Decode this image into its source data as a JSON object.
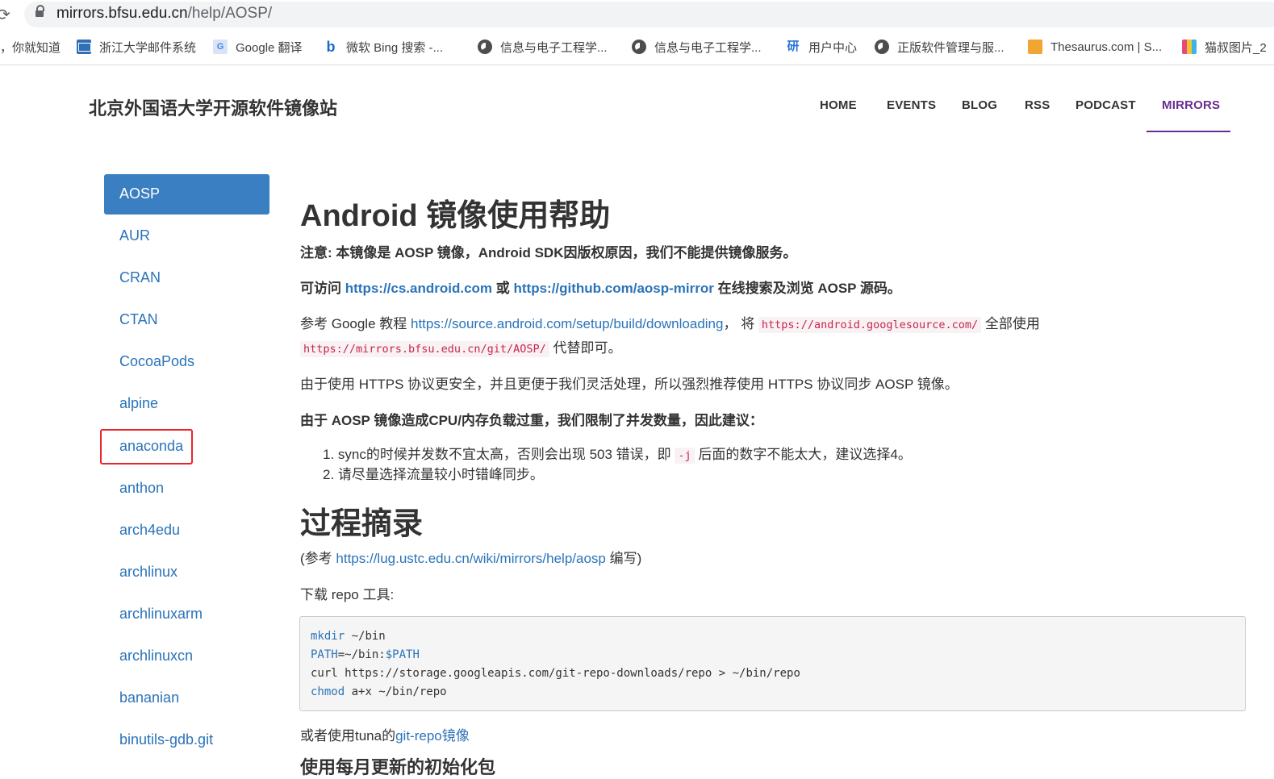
{
  "browser": {
    "url_host": "mirrors.bfsu.edu.cn",
    "url_path": "/help/AOSP/",
    "bookmarks": [
      {
        "label": "，你就知道",
        "icon": "none"
      },
      {
        "label": "浙江大学邮件系统",
        "icon": "mail-icon"
      },
      {
        "label": "Google 翻译",
        "icon": "translate-icon"
      },
      {
        "label": "微软 Bing 搜索 -...",
        "icon": "bing-icon"
      },
      {
        "label": "信息与电子工程学...",
        "icon": "globe-icon"
      },
      {
        "label": "信息与电子工程学...",
        "icon": "globe-icon"
      },
      {
        "label": "用户中心",
        "icon": "yan-icon"
      },
      {
        "label": "正版软件管理与服...",
        "icon": "globe-icon"
      },
      {
        "label": "Thesaurus.com | S...",
        "icon": "thesaurus-icon"
      },
      {
        "label": "猫叔图片_2",
        "icon": "cat-icon"
      }
    ]
  },
  "site": {
    "title": "北京外国语大学开源软件镜像站",
    "nav": [
      "HOME",
      "EVENTS",
      "BLOG",
      "RSS",
      "PODCAST",
      "MIRRORS"
    ],
    "active_nav": "MIRRORS"
  },
  "sidebar": {
    "active": "AOSP",
    "items": [
      "AUR",
      "CRAN",
      "CTAN",
      "CocoaPods",
      "alpine",
      "anaconda",
      "anthon",
      "arch4edu",
      "archlinux",
      "archlinuxarm",
      "archlinuxcn",
      "bananian",
      "binutils-gdb.git"
    ]
  },
  "content": {
    "h1": "Android 镜像使用帮助",
    "notice": "注意: 本镜像是 AOSP 镜像，Android SDK因版权原因，我们不能提供镜像服务。",
    "visit_pre": "可访问 ",
    "visit_link1": "https://cs.android.com",
    "visit_mid": " 或 ",
    "visit_link2": "https://github.com/aosp-mirror",
    "visit_post": " 在线搜索及浏览 AOSP 源码。",
    "ref_pre": "参考 Google 教程 ",
    "ref_link": "https://source.android.com/setup/build/downloading",
    "ref_mid": "， 将 ",
    "ref_code1": "https://android.googlesource.com/",
    "ref_post": " 全部使用",
    "ref_code2": "https://mirrors.bfsu.edu.cn/git/AOSP/",
    "ref_end": " 代替即可。",
    "https_note": "由于使用 HTTPS 协议更安全，并且更便于我们灵活处理，所以强烈推荐使用 HTTPS 协议同步 AOSP 镜像。",
    "limit_note": "由于 AOSP 镜像造成CPU/内存负载过重，我们限制了并发数量，因此建议：",
    "ol1_pre": "1. sync的时候并发数不宜太高，否则会出现 503 错误，即 ",
    "ol1_code": "-j",
    "ol1_post": " 后面的数字不能太大，建议选择4。",
    "ol2": "2. 请尽量选择流量较小时错峰同步。",
    "h2": "过程摘录",
    "ustc_pre": "(参考 ",
    "ustc_link": "https://lug.ustc.edu.cn/wiki/mirrors/help/aosp",
    "ustc_post": " 编写)",
    "repo_label": "下载 repo 工具:",
    "code": {
      "l1_kw": "mkdir",
      "l1_rest": " ~/bin",
      "l2_var": "PATH",
      "l2_mid": "=~/bin:",
      "l2_var2": "$PATH",
      "l3": "curl https://storage.googleapis.com/git-repo-downloads/repo > ~/bin/repo",
      "l4_kw": "chmod",
      "l4_rest": " a+x ~/bin/repo"
    },
    "tuna_pre": "或者使用tuna的",
    "tuna_link": "git-repo镜像",
    "next_heading": "使用每月更新的初始化包"
  }
}
